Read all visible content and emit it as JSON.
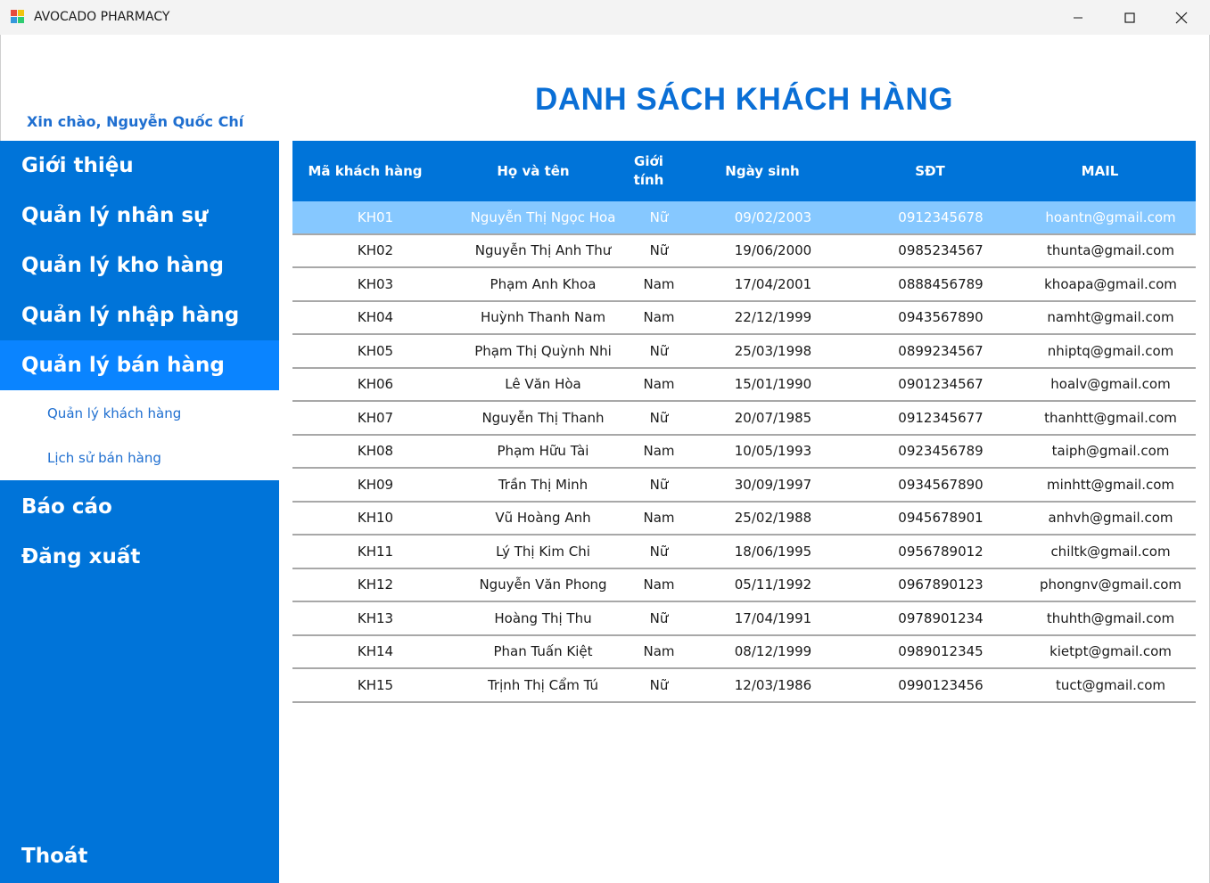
{
  "window": {
    "title": "AVOCADO PHARMACY",
    "icon": "app-window-icon",
    "controls": [
      "minimize-icon",
      "maximize-icon",
      "close-icon"
    ]
  },
  "greeting": "Xin chào, Nguyễn Quốc Chí",
  "sidebar": {
    "items": [
      {
        "label": "Giới thiệu"
      },
      {
        "label": "Quản lý nhân sự"
      },
      {
        "label": "Quản lý kho hàng"
      },
      {
        "label": "Quản lý nhập hàng"
      },
      {
        "label": "Quản lý bán hàng",
        "active": true
      },
      {
        "label": "Báo cáo"
      },
      {
        "label": "Đăng xuất"
      }
    ],
    "submenu": [
      {
        "label": "Quản lý khách hàng"
      },
      {
        "label": "Lịch sử bán hàng"
      }
    ],
    "exit_label": "Thoát"
  },
  "page_title": "DANH SÁCH KHÁCH HÀNG",
  "table": {
    "columns": [
      "Mã khách hàng",
      "Họ và tên",
      "Giới tính",
      "Ngày sinh",
      "SĐT",
      "MAIL"
    ],
    "selected_row": 0,
    "rows": [
      [
        "KH01",
        "Nguyễn Thị Ngọc Hoa",
        "Nữ",
        "09/02/2003",
        "0912345678",
        "hoantn@gmail.com"
      ],
      [
        "KH02",
        "Nguyễn Thị Anh Thư",
        "Nữ",
        "19/06/2000",
        "0985234567",
        "thunta@gmail.com"
      ],
      [
        "KH03",
        "Phạm Anh Khoa",
        "Nam",
        "17/04/2001",
        "0888456789",
        "khoapa@gmail.com"
      ],
      [
        "KH04",
        "Huỳnh Thanh Nam",
        "Nam",
        "22/12/1999",
        "0943567890",
        "namht@gmail.com"
      ],
      [
        "KH05",
        "Phạm Thị Quỳnh Nhi",
        "Nữ",
        "25/03/1998",
        "0899234567",
        "nhiptq@gmail.com"
      ],
      [
        "KH06",
        "Lê Văn Hòa",
        "Nam",
        "15/01/1990",
        "0901234567",
        "hoalv@gmail.com"
      ],
      [
        "KH07",
        "Nguyễn Thị Thanh",
        "Nữ",
        "20/07/1985",
        "0912345677",
        "thanhtt@gmail.com"
      ],
      [
        "KH08",
        "Phạm Hữu Tài",
        "Nam",
        "10/05/1993",
        "0923456789",
        "taiph@gmail.com"
      ],
      [
        "KH09",
        "Trần Thị Minh",
        "Nữ",
        "30/09/1997",
        "0934567890",
        "minhtt@gmail.com"
      ],
      [
        "KH10",
        "Vũ Hoàng Anh",
        "Nam",
        "25/02/1988",
        "0945678901",
        "anhvh@gmail.com"
      ],
      [
        "KH11",
        "Lý Thị Kim Chi",
        "Nữ",
        "18/06/1995",
        "0956789012",
        "chiltk@gmail.com"
      ],
      [
        "KH12",
        "Nguyễn Văn Phong",
        "Nam",
        "05/11/1992",
        "0967890123",
        "phongnv@gmail.com"
      ],
      [
        "KH13",
        "Hoàng Thị Thu",
        "Nữ",
        "17/04/1991",
        "0978901234",
        "thuhth@gmail.com"
      ],
      [
        "KH14",
        "Phan Tuấn Kiệt",
        "Nam",
        "08/12/1999",
        "0989012345",
        "kietpt@gmail.com"
      ],
      [
        "KH15",
        "Trịnh Thị Cẩm Tú",
        "Nữ",
        "12/03/1986",
        "0990123456",
        "tuct@gmail.com"
      ]
    ]
  },
  "colors": {
    "sidebar": "#0074d9",
    "sidebar_active": "#0a84ff",
    "header": "#0074d9",
    "selected_row": "#86c8ff",
    "title": "#0a6fd6"
  }
}
